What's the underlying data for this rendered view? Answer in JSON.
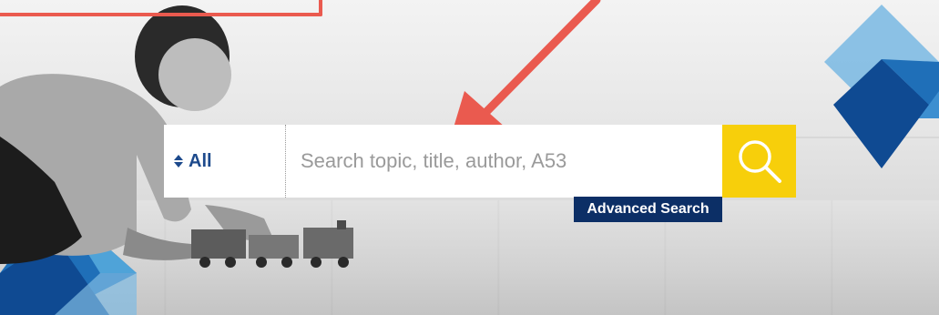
{
  "search": {
    "scope_label": "All",
    "placeholder": "Search topic, title, author, A53",
    "value": "",
    "button_icon": "search-icon",
    "advanced_label": "Advanced Search"
  },
  "colors": {
    "brand_blue": "#1d4a8c",
    "advanced_bg": "#0c2f66",
    "search_button": "#f7cf0b",
    "annotation": "#ea5a4f",
    "diamond_light": "#4fa3d8",
    "diamond_mid": "#1f6fb8",
    "diamond_dark": "#0f4a92"
  },
  "icons": {
    "scope_toggle": "sort-updown-icon",
    "annotation_arrow": "arrow-icon"
  }
}
